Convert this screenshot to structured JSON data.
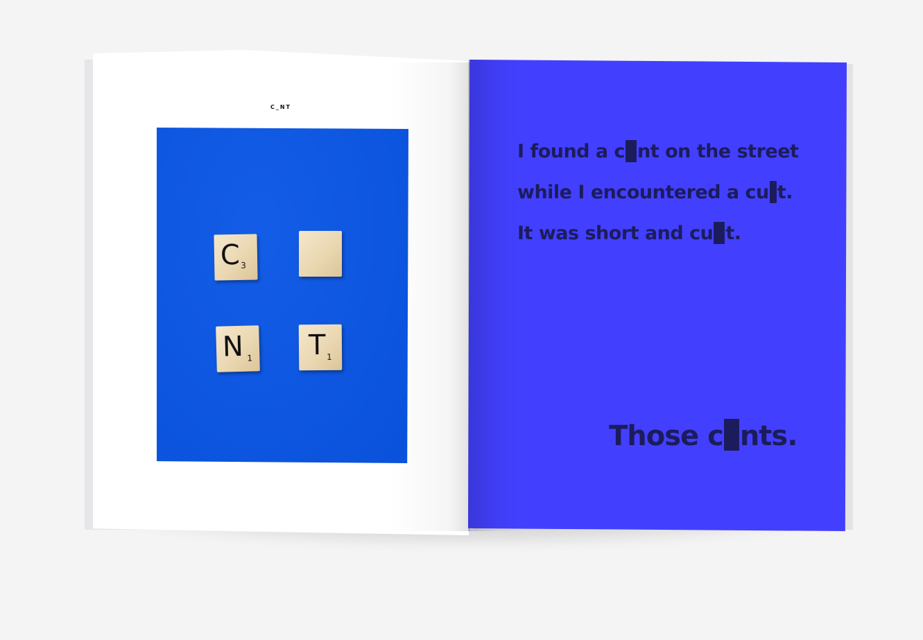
{
  "scene": {
    "background_color": "#f4f4f5"
  },
  "left_page": {
    "header": "C_NT",
    "photo_color": "#0a56e6",
    "tiles": [
      {
        "letter": "C",
        "score": "3"
      },
      {
        "letter": "",
        "score": ""
      },
      {
        "letter": "N",
        "score": "1"
      },
      {
        "letter": "T",
        "score": "1"
      }
    ]
  },
  "right_page": {
    "background_color": "#4240fe",
    "text_color": "#1c1c5c",
    "lines": [
      {
        "before": "I found a c",
        "after": "nt on the street"
      },
      {
        "before": "while I encountered a cu",
        "after": "t."
      },
      {
        "before": "It was short and cu",
        "after": "t."
      }
    ],
    "closing": {
      "before": "Those c",
      "after": "nts."
    }
  }
}
